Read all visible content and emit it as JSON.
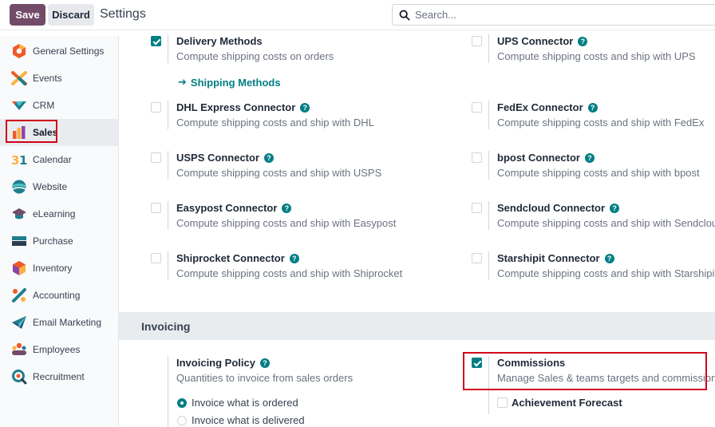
{
  "toolbar": {
    "save_label": "Save",
    "discard_label": "Discard",
    "title": "Settings"
  },
  "search": {
    "placeholder": "Search..."
  },
  "sidebar": {
    "items": [
      {
        "label": "General Settings",
        "icon": "general-settings-icon"
      },
      {
        "label": "Events",
        "icon": "events-icon"
      },
      {
        "label": "CRM",
        "icon": "crm-icon"
      },
      {
        "label": "Sales",
        "icon": "sales-icon",
        "active": true
      },
      {
        "label": "Calendar",
        "icon": "calendar-icon"
      },
      {
        "label": "Website",
        "icon": "website-icon"
      },
      {
        "label": "eLearning",
        "icon": "elearning-icon"
      },
      {
        "label": "Purchase",
        "icon": "purchase-icon"
      },
      {
        "label": "Inventory",
        "icon": "inventory-icon"
      },
      {
        "label": "Accounting",
        "icon": "accounting-icon"
      },
      {
        "label": "Email Marketing",
        "icon": "email-marketing-icon"
      },
      {
        "label": "Employees",
        "icon": "employees-icon"
      },
      {
        "label": "Recruitment",
        "icon": "recruitment-icon"
      }
    ]
  },
  "shipping": {
    "delivery": {
      "title": "Delivery Methods",
      "desc": "Compute shipping costs on orders",
      "checked": true,
      "link": "Shipping Methods"
    },
    "ups": {
      "title": "UPS Connector",
      "desc": "Compute shipping costs and ship with UPS",
      "checked": false
    },
    "dhl": {
      "title": "DHL Express Connector",
      "desc": "Compute shipping costs and ship with DHL",
      "checked": false
    },
    "fedex": {
      "title": "FedEx Connector",
      "desc": "Compute shipping costs and ship with FedEx",
      "checked": false
    },
    "usps": {
      "title": "USPS Connector",
      "desc": "Compute shipping costs and ship with USPS",
      "checked": false
    },
    "bpost": {
      "title": "bpost Connector",
      "desc": "Compute shipping costs and ship with bpost",
      "checked": false
    },
    "easypost": {
      "title": "Easypost Connector",
      "desc": "Compute shipping costs and ship with Easypost",
      "checked": false
    },
    "sendcloud": {
      "title": "Sendcloud Connector",
      "desc": "Compute shipping costs and ship with Sendcloud",
      "checked": false
    },
    "shiprocket": {
      "title": "Shiprocket Connector",
      "desc": "Compute shipping costs and ship with Shiprocket",
      "checked": false
    },
    "starshipit": {
      "title": "Starshipit Connector",
      "desc": "Compute shipping costs and ship with Starshipit",
      "checked": false
    }
  },
  "invoicing": {
    "section_title": "Invoicing",
    "policy": {
      "title": "Invoicing Policy",
      "desc": "Quantities to invoice from sales orders",
      "options": [
        "Invoice what is ordered",
        "Invoice what is delivered"
      ],
      "selected": "Invoice what is ordered"
    },
    "commissions": {
      "title": "Commissions",
      "desc": "Manage Sales & teams targets and commissions",
      "checked": true,
      "sub_option": "Achievement Forecast"
    }
  },
  "colors": {
    "brand": "#714b67",
    "accent": "#017e84",
    "highlight": "#d0021b"
  }
}
